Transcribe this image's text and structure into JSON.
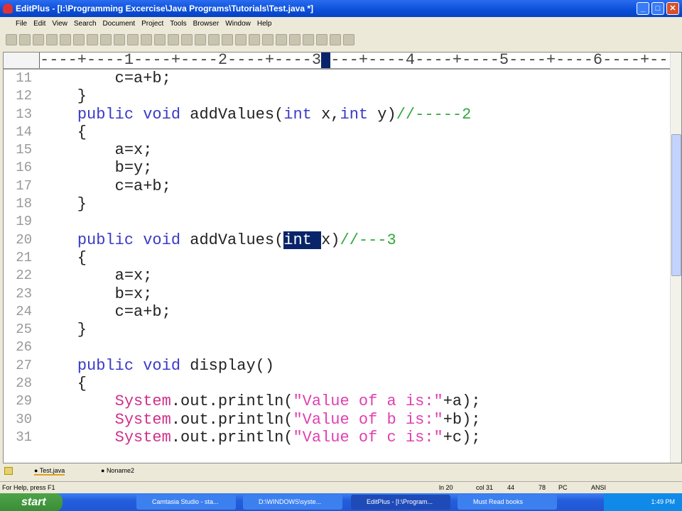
{
  "window": {
    "title": "EditPlus - [I:\\Programming Excercise\\Java Programs\\Tutorials\\Test.java *]"
  },
  "menu": [
    "File",
    "Edit",
    "View",
    "Search",
    "Document",
    "Project",
    "Tools",
    "Browser",
    "Window",
    "Help"
  ],
  "ruler": "----+----1----+----2----+----3----+----4----+----5----+----6----+----",
  "code": [
    {
      "n": "11",
      "t": [
        [
          "        c=a+b;",
          ""
        ]
      ]
    },
    {
      "n": "12",
      "t": [
        [
          "    }",
          ""
        ]
      ]
    },
    {
      "n": "13",
      "t": [
        [
          "    ",
          ""
        ],
        [
          "public void",
          "kw"
        ],
        [
          " addValues(",
          ""
        ],
        [
          "int",
          "kw"
        ],
        [
          " x,",
          ""
        ],
        [
          "int",
          "kw"
        ],
        [
          " y)",
          ""
        ],
        [
          "//-----2",
          "cm"
        ]
      ]
    },
    {
      "n": "14",
      "t": [
        [
          "    {",
          ""
        ]
      ]
    },
    {
      "n": "15",
      "t": [
        [
          "        a=x;",
          ""
        ]
      ]
    },
    {
      "n": "16",
      "t": [
        [
          "        b=y;",
          ""
        ]
      ]
    },
    {
      "n": "17",
      "t": [
        [
          "        c=a+b;",
          ""
        ]
      ]
    },
    {
      "n": "18",
      "t": [
        [
          "    }",
          ""
        ]
      ]
    },
    {
      "n": "19",
      "t": []
    },
    {
      "n": "20",
      "t": [
        [
          "    ",
          ""
        ],
        [
          "public void",
          "kw"
        ],
        [
          " addValues(",
          ""
        ],
        [
          "int ",
          "sel"
        ],
        [
          "x)",
          ""
        ],
        [
          "//---3",
          "cm"
        ]
      ]
    },
    {
      "n": "21",
      "t": [
        [
          "    {",
          ""
        ]
      ]
    },
    {
      "n": "22",
      "t": [
        [
          "        a=x;",
          ""
        ]
      ]
    },
    {
      "n": "23",
      "t": [
        [
          "        b=x;",
          ""
        ]
      ]
    },
    {
      "n": "24",
      "t": [
        [
          "        c=a+b;",
          ""
        ]
      ]
    },
    {
      "n": "25",
      "t": [
        [
          "    }",
          ""
        ]
      ]
    },
    {
      "n": "26",
      "t": []
    },
    {
      "n": "27",
      "t": [
        [
          "    ",
          ""
        ],
        [
          "public void",
          "kw"
        ],
        [
          " display()",
          ""
        ]
      ]
    },
    {
      "n": "28",
      "t": [
        [
          "    {",
          ""
        ]
      ]
    },
    {
      "n": "29",
      "t": [
        [
          "        ",
          ""
        ],
        [
          "System",
          "sy"
        ],
        [
          ".out.println(",
          ""
        ],
        [
          "\"Value of a is:\"",
          "st"
        ],
        [
          "+a);",
          ""
        ]
      ]
    },
    {
      "n": "30",
      "t": [
        [
          "        ",
          ""
        ],
        [
          "System",
          "sy"
        ],
        [
          ".out.println(",
          ""
        ],
        [
          "\"Value of b is:\"",
          "st"
        ],
        [
          "+b);",
          ""
        ]
      ]
    },
    {
      "n": "31",
      "t": [
        [
          "        ",
          ""
        ],
        [
          "System",
          "sy"
        ],
        [
          ".out.println(",
          ""
        ],
        [
          "\"Value of c is:\"",
          "st"
        ],
        [
          "+c);",
          ""
        ]
      ]
    }
  ],
  "tabs": [
    "Test.java",
    "Noname2"
  ],
  "status": {
    "help": "For Help, press F1",
    "ln": "ln 20",
    "col": "col 31",
    "c1": "44",
    "c2": "78",
    "mode": "PC",
    "enc": "ANSI"
  },
  "taskbar": {
    "start": "start",
    "tasks": [
      "Camtasia Studio - sta...",
      "D:\\WINDOWS\\syste...",
      "EditPlus - [I:\\Program...",
      "Must Read books"
    ],
    "clock": "1:49 PM"
  }
}
